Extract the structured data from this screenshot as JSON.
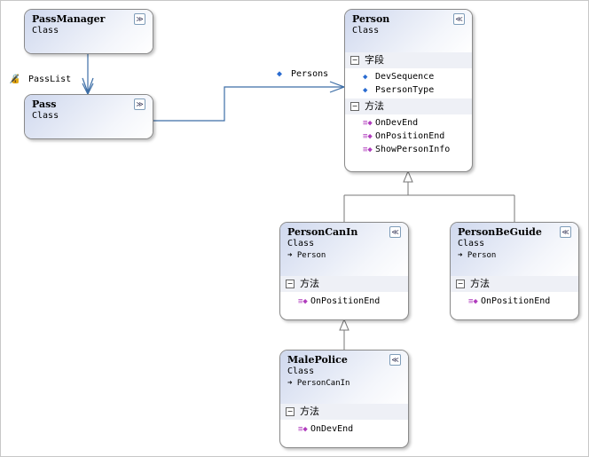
{
  "classes": {
    "passmanager": {
      "name": "PassManager",
      "kind": "Class",
      "toggle": "expand"
    },
    "pass": {
      "name": "Pass",
      "kind": "Class",
      "toggle": "expand"
    },
    "person": {
      "name": "Person",
      "kind": "Class",
      "toggle": "collapse",
      "fields_label": "字段",
      "fields": [
        "DevSequence",
        "PsersonType"
      ],
      "methods_label": "方法",
      "methods": [
        "OnDevEnd",
        "OnPositionEnd",
        "ShowPersonInfo"
      ]
    },
    "personcanin": {
      "name": "PersonCanIn",
      "kind": "Class",
      "base": "Person",
      "methods_label": "方法",
      "methods": [
        "OnPositionEnd"
      ]
    },
    "personbeguide": {
      "name": "PersonBeGuide",
      "kind": "Class",
      "base": "Person",
      "methods_label": "方法",
      "methods": [
        "OnPositionEnd"
      ]
    },
    "malepolice": {
      "name": "MalePolice",
      "kind": "Class",
      "base": "PersonCanIn",
      "methods_label": "方法",
      "methods": [
        "OnDevEnd"
      ]
    }
  },
  "associations": {
    "passlist": "PassList",
    "persons": "Persons"
  },
  "icons": {
    "expand": "double-chevron-down",
    "collapse": "double-chevron-up",
    "field": "field-diamond",
    "method": "method-cube",
    "inherits": "arrow-right"
  }
}
